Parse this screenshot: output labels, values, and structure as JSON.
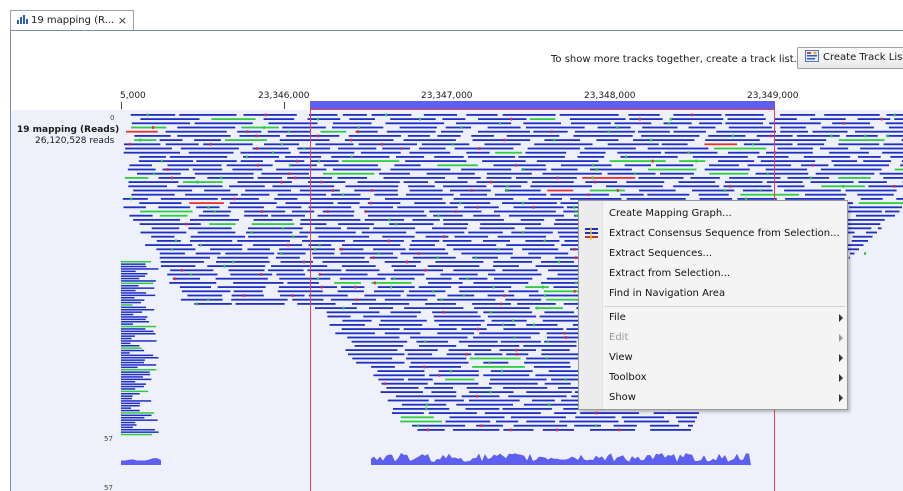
{
  "tab": {
    "label": "19 mapping (R...",
    "close": "×"
  },
  "hint_text": "To show more tracks together, create a track list.",
  "create_button_label": "Create Track List",
  "ruler": [
    "5,000",
    "23,346,000",
    "23,347,000",
    "23,348,000",
    "23,349,000"
  ],
  "track": {
    "title": "19 mapping (Reads)",
    "read_count": "26,120,528 reads",
    "axis_top": "0",
    "axis_coverage": "57",
    "axis_coverage_b": "57"
  },
  "context_menu": {
    "items": [
      {
        "label": "Create Mapping Graph...",
        "disabled": false,
        "submenu": false,
        "icon": ""
      },
      {
        "label": "Extract Consensus Sequence from Selection...",
        "disabled": false,
        "submenu": false,
        "icon": "consensus-icon"
      },
      {
        "label": "Extract Sequences...",
        "disabled": false,
        "submenu": false,
        "icon": ""
      },
      {
        "label": "Extract from Selection...",
        "disabled": false,
        "submenu": false,
        "icon": ""
      },
      {
        "label": "Find in Navigation Area",
        "disabled": false,
        "submenu": false,
        "icon": ""
      },
      {
        "label": "File",
        "disabled": false,
        "submenu": true,
        "icon": ""
      },
      {
        "label": "Edit",
        "disabled": true,
        "submenu": true,
        "icon": ""
      },
      {
        "label": "View",
        "disabled": false,
        "submenu": true,
        "icon": ""
      },
      {
        "label": "Toolbox",
        "disabled": false,
        "submenu": true,
        "icon": ""
      },
      {
        "label": "Show",
        "disabled": false,
        "submenu": true,
        "icon": ""
      }
    ]
  },
  "colors": {
    "read": "#1f2fc4",
    "selection": "#5c5ff0",
    "selection_border": "#e8434a",
    "mismatch_green": "#2ecc40",
    "mismatch_red": "#e63030",
    "mismatch_yellow": "#e8d020",
    "track_bg": "#eef0fb"
  }
}
